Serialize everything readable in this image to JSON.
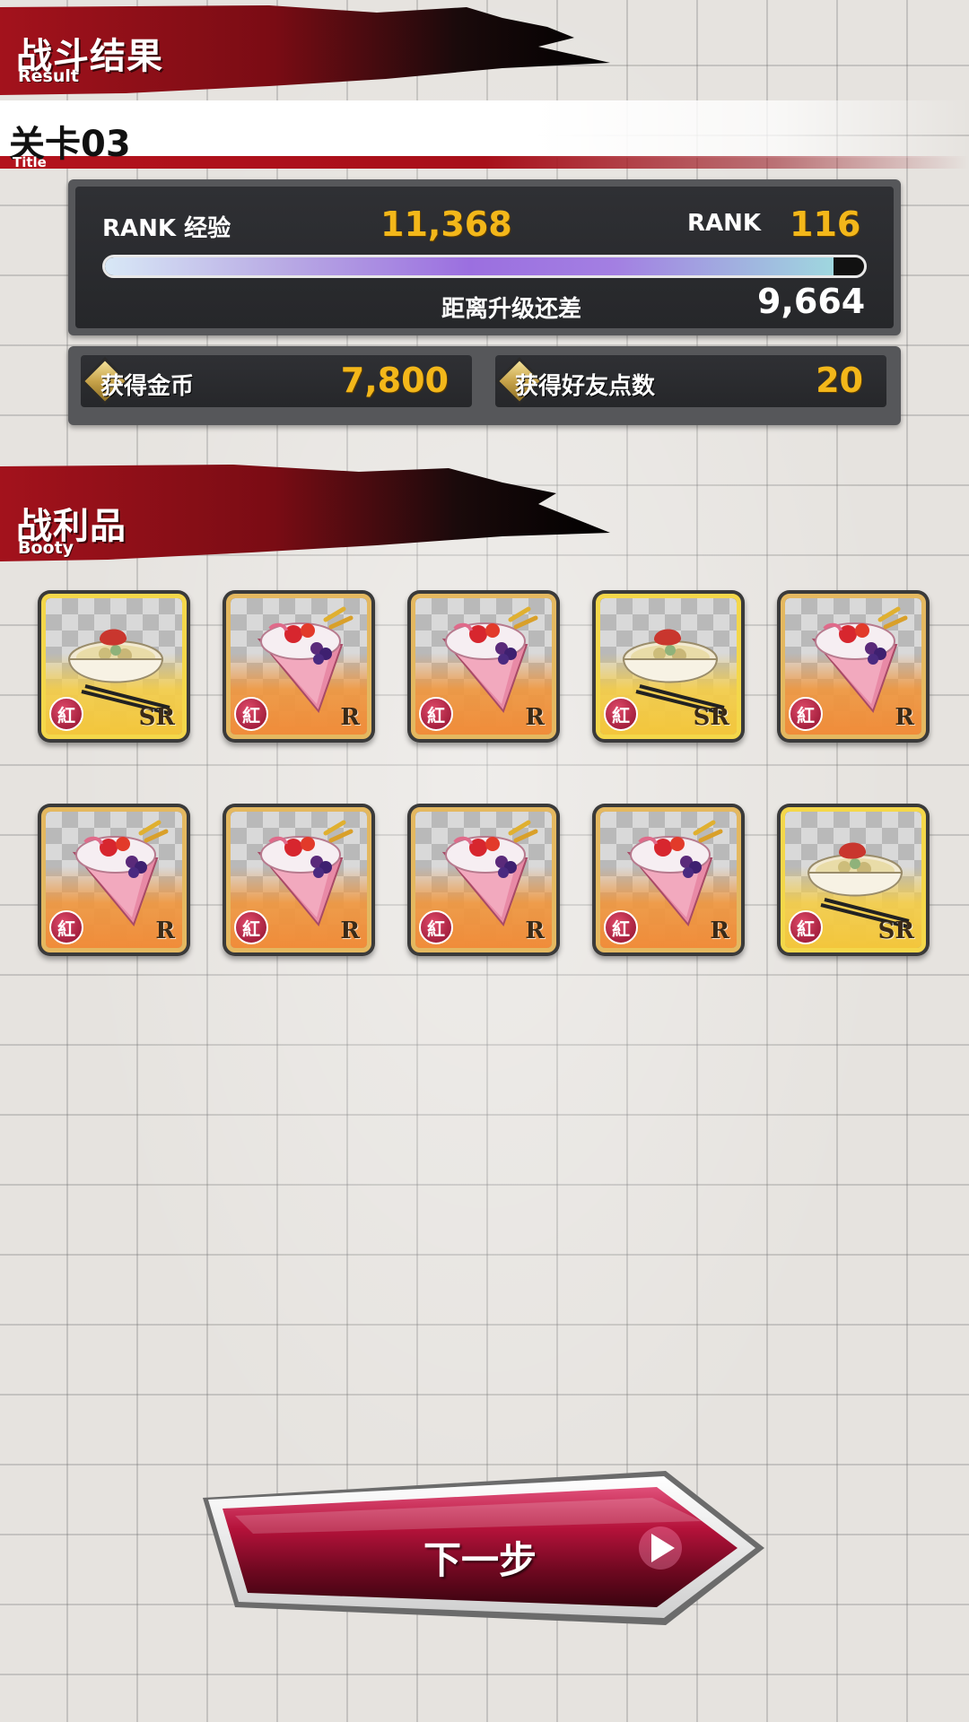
{
  "header": {
    "title": "战斗结果",
    "subtitle": "Result"
  },
  "stage": {
    "name": "关卡03",
    "sub": "Title"
  },
  "rank_panel": {
    "exp_label": "RANK 经验",
    "exp_value": "11,368",
    "rank_label": "RANK",
    "rank_value": "116",
    "exp_progress": 0.96,
    "next_label": "距离升级还差",
    "next_value": "9,664"
  },
  "rewards": {
    "coin_label": "获得金币",
    "coin_value": "7,800",
    "friend_label": "获得好友点数",
    "friend_value": "20"
  },
  "booty": {
    "title": "战利品",
    "subtitle": "Booty",
    "items": [
      {
        "type": "bowl-icon",
        "tag": "紅",
        "rarity": "SR"
      },
      {
        "type": "crepe-icon",
        "tag": "紅",
        "rarity": "R"
      },
      {
        "type": "crepe-icon",
        "tag": "紅",
        "rarity": "R"
      },
      {
        "type": "bowl-icon",
        "tag": "紅",
        "rarity": "SR"
      },
      {
        "type": "crepe-icon",
        "tag": "紅",
        "rarity": "R"
      },
      {
        "type": "crepe-icon",
        "tag": "紅",
        "rarity": "R"
      },
      {
        "type": "crepe-icon",
        "tag": "紅",
        "rarity": "R"
      },
      {
        "type": "crepe-icon",
        "tag": "紅",
        "rarity": "R"
      },
      {
        "type": "crepe-icon",
        "tag": "紅",
        "rarity": "R"
      },
      {
        "type": "bowl-icon",
        "tag": "紅",
        "rarity": "SR"
      }
    ]
  },
  "next_button": {
    "label": "下一步"
  },
  "colors": {
    "accent_gold": "#f3b71a",
    "banner_red": "#a8101a",
    "button_red": "#b4123a"
  }
}
